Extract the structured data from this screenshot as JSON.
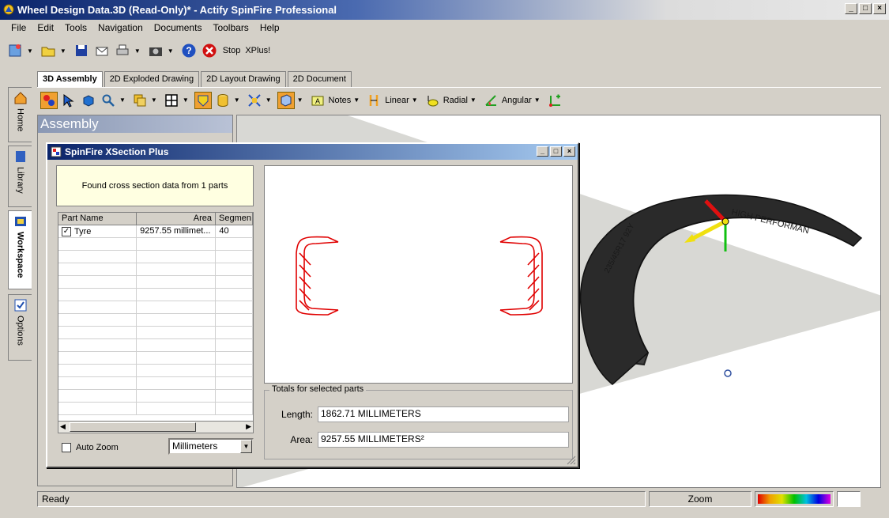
{
  "app": {
    "title": "Wheel Design Data.3D (Read-Only)* - Actify SpinFire Professional"
  },
  "menu": [
    "File",
    "Edit",
    "Tools",
    "Navigation",
    "Documents",
    "Toolbars",
    "Help"
  ],
  "toolbar": {
    "stop_label": "Stop",
    "xplus_label": "XPlus!"
  },
  "sidebar_tabs": [
    "Home",
    "Library",
    "Workspace",
    "Options"
  ],
  "doc_tabs": [
    "3D Assembly",
    "2D Exploded Drawing",
    "2D Layout Drawing",
    "2D Document"
  ],
  "measure_toolbar": {
    "notes": "Notes",
    "linear": "Linear",
    "radial": "Radial",
    "angular": "Angular"
  },
  "assembly_panel": {
    "title": "Assembly"
  },
  "dialog": {
    "title": "SpinFire XSection Plus",
    "message": "Found cross section data from 1 parts",
    "columns": [
      "Part Name",
      "Area",
      "Segmen"
    ],
    "rows": [
      {
        "checked": true,
        "name": "Tyre",
        "area": "9257.55 millimet...",
        "segments": "40"
      }
    ],
    "auto_zoom_label": "Auto Zoom",
    "units": "Millimeters",
    "totals_legend": "Totals for selected parts",
    "length_label": "Length:",
    "length_value": "1862.71 MILLIMETERS",
    "area_label": "Area:",
    "area_value": "9257.55 MILLIMETERS²"
  },
  "tire_markings": {
    "sidewall": "HIGH PERFORMAN",
    "size": "235/45R17 92Y"
  },
  "status": {
    "ready": "Ready",
    "zoom": "Zoom"
  },
  "colors": {
    "section_outline": "#e00000",
    "title_active": "#0a246a"
  }
}
